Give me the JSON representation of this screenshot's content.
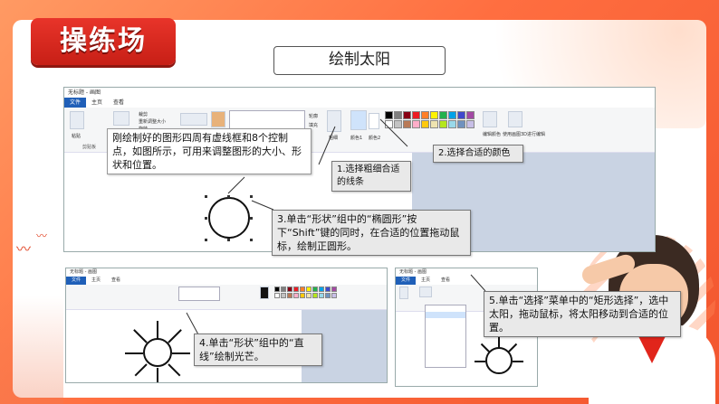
{
  "slide": {
    "badge_title": "操练场",
    "subtitle": "绘制太阳"
  },
  "paint_main": {
    "window_title": "无标题 - 画图",
    "tabs": [
      "文件",
      "主页",
      "查看"
    ],
    "groups": {
      "clipboard_label": "粘贴",
      "clipboard_group": "剪贴板",
      "crop": "裁剪",
      "resize": "重新调整大小",
      "rotate": "旋转",
      "outline": "轮廓",
      "fill": "填充",
      "size": "粗细",
      "color1": "颜色1",
      "color2": "颜色2",
      "edit_colors": "编辑颜色",
      "paint3d": "使用画图3D进行编辑"
    }
  },
  "palette": [
    "#000000",
    "#7f7f7f",
    "#880015",
    "#ed1c24",
    "#ff7f27",
    "#fff200",
    "#22b14c",
    "#00a2e8",
    "#3f48cc",
    "#a349a4",
    "#ffffff",
    "#c3c3c3",
    "#b97a57",
    "#ffaec9",
    "#ffc90e",
    "#efe4b0",
    "#b5e61d",
    "#99d9ea",
    "#7092be",
    "#c8bfe7"
  ],
  "callouts": {
    "c_intro": "刚绘制好的图形四周有虚线框和8个控制点，如图所示，可用来调整图形的大小、形状和位置。",
    "c1": "1.选择粗细合适的线条",
    "c2": "2.选择合适的颜色",
    "c3": "3.单击“形状”组中的“椭圆形”按下“Shift”键的同时，在合适的位置拖动鼠标，绘制正圆形。",
    "c4": "4.单击“形状”组中的“直线”绘制光芒。",
    "c5": "5.单击“选择”菜单中的“矩形选择”，选中太阳，拖动鼠标，将太阳移动到合适的位置。"
  },
  "paint_b": {
    "window_title": "无标题 - 画图",
    "tabs": [
      "文件",
      "主页",
      "查看"
    ]
  },
  "paint_c": {
    "window_title": "无标题 - 画图",
    "tabs": [
      "文件",
      "主页",
      "查看"
    ]
  }
}
